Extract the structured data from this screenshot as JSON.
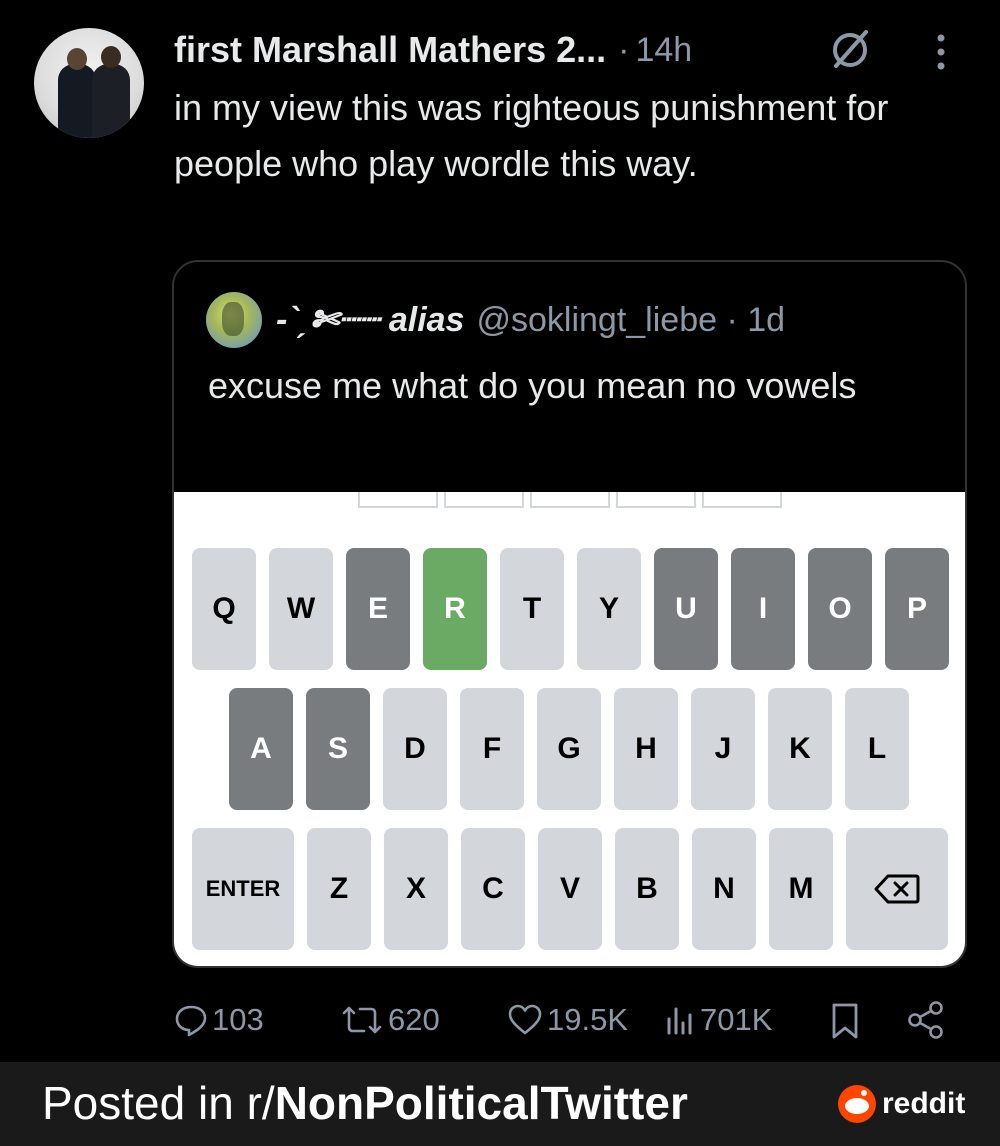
{
  "post": {
    "author_name": "first Marshall Mathers 2...",
    "separator": "·",
    "time": "14h",
    "text": "in my view this was righteous punishment for people who play wordle this way.",
    "icons": {
      "status": "slashed-circle-icon",
      "more": "more-vertical-icon"
    }
  },
  "quote": {
    "author_name": "-ˋˏ✄┈┈ alias",
    "handle_time": "@soklingt_liebe · 1d",
    "text": "excuse me what do you mean no vowels",
    "keyboard": {
      "rows": [
        [
          {
            "label": "Q",
            "state": "unused"
          },
          {
            "label": "W",
            "state": "unused"
          },
          {
            "label": "E",
            "state": "absent"
          },
          {
            "label": "R",
            "state": "correct"
          },
          {
            "label": "T",
            "state": "unused"
          },
          {
            "label": "Y",
            "state": "unused"
          },
          {
            "label": "U",
            "state": "absent"
          },
          {
            "label": "I",
            "state": "absent"
          },
          {
            "label": "O",
            "state": "absent"
          },
          {
            "label": "P",
            "state": "absent"
          }
        ],
        [
          {
            "label": "A",
            "state": "absent"
          },
          {
            "label": "S",
            "state": "absent"
          },
          {
            "label": "D",
            "state": "unused"
          },
          {
            "label": "F",
            "state": "unused"
          },
          {
            "label": "G",
            "state": "unused"
          },
          {
            "label": "H",
            "state": "unused"
          },
          {
            "label": "J",
            "state": "unused"
          },
          {
            "label": "K",
            "state": "unused"
          },
          {
            "label": "L",
            "state": "unused"
          }
        ],
        [
          {
            "label": "ENTER",
            "state": "unused"
          },
          {
            "label": "Z",
            "state": "unused"
          },
          {
            "label": "X",
            "state": "unused"
          },
          {
            "label": "C",
            "state": "unused"
          },
          {
            "label": "V",
            "state": "unused"
          },
          {
            "label": "B",
            "state": "unused"
          },
          {
            "label": "N",
            "state": "unused"
          },
          {
            "label": "M",
            "state": "unused"
          },
          {
            "label": "",
            "state": "unused",
            "icon": "backspace-icon"
          }
        ]
      ],
      "colors": {
        "unused": "#d3d6da",
        "absent": "#787c7e",
        "correct": "#6aaa64"
      }
    }
  },
  "actions": {
    "replies": "103",
    "reposts": "620",
    "likes": "19.5K",
    "views": "701K",
    "icons": [
      "reply-icon",
      "repost-icon",
      "like-icon",
      "views-icon",
      "bookmark-icon",
      "share-icon"
    ]
  },
  "banner": {
    "prefix": "Posted in r/",
    "subreddit": "NonPoliticalTwitter",
    "brand": "reddit"
  }
}
